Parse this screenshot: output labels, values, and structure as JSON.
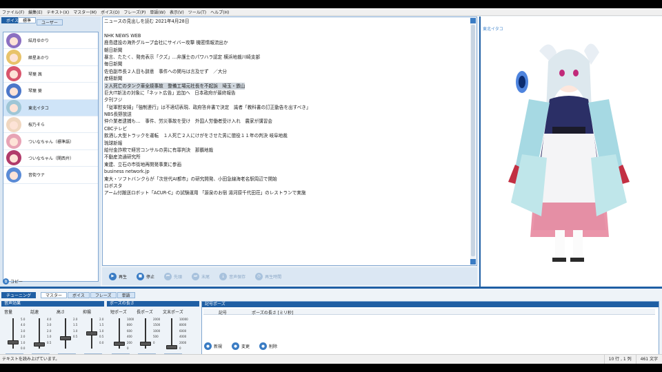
{
  "menu": [
    "ファイル(F)",
    "編集(E)",
    "テキスト(X)",
    "マスター(M)",
    "ボイス(O)",
    "フレーズ(P)",
    "単語(W)",
    "表示(V)",
    "ツール(T)",
    "ヘルプ(H)"
  ],
  "left_tabs": {
    "voice": "ボイス",
    "standard": "標準",
    "user": "ユーザー"
  },
  "voices": [
    {
      "name": "結月ゆかり",
      "color": "#8b6fc1"
    },
    {
      "name": "紲星あかり",
      "color": "#e8c36a"
    },
    {
      "name": "琴葉 茜",
      "color": "#d9556c"
    },
    {
      "name": "琴葉 葵",
      "color": "#4c77c9"
    },
    {
      "name": "東北イタコ",
      "color": "#9fc6d6"
    },
    {
      "name": "桜乃そら",
      "color": "#f0d7c0"
    },
    {
      "name": "ついなちゃん（標準語）",
      "color": "#e7a3b5"
    },
    {
      "name": "ついなちゃん（関西弁）",
      "color": "#b13b6a"
    },
    {
      "name": "音街ウナ",
      "color": "#5a8bd6"
    }
  ],
  "selected_voice_index": 4,
  "copy_label": "コピー",
  "editor_lines": [
    "ニュースの見出しを読む 2021年4月28日",
    "",
    "NHK NEWS WEB",
    "鹿島建設の海外グループ会社にサイバー攻撃 機密情報流出か",
    "朝日新聞",
    "暴言、たたく、発売表示「クズ」…弁護士のパワハラ認定 横浜地裁川崎支部",
    "毎日新聞",
    "佐伯副市長２人目も辞意　事件への関与は言及せず　／大分",
    "産経新聞",
    "２人死亡のタンク車全焼事故　整備工場元社長を不起訴　埼玉・鉄山",
    "巨大IT新法の対象に「ネット広告」追加へ　日本政府が最終報告",
    "夕刊フジ",
    "「従軍慰安婦」「強制連行」は不適切表現、政府答弁書で決定　識者「教科書の訂正動告を出すべき」",
    "NBS長野放送",
    "仲介業者逮捕も…　事件、労災事故を受け　外国人労働者受け入れ　農家が講習会",
    "CBCテレビ",
    "飲酒し大型トラックを運転　１人死亡２人にけがをさせた男に懲役１１年の判決 岐阜地裁",
    "琉球新報",
    "給付金詐欺で経営コンサルの男に有罪判決　那覇地裁",
    "不動産流通研究所",
    "東建、立石の市街地再開発事業に参画",
    "business network.jp",
    "東大・ソフトバンクらが「次世代AI都市」の研究開発、小田急線海老名駅周辺で開始",
    "ロボスタ",
    "アーム付搬送ロボット「ACUR-C」の試験運用 「源泉のお宿 湯河原千代田荘」のレストランで実施"
  ],
  "highlight_line_index": 9,
  "playbar": [
    {
      "label": "再生",
      "icon": "play-icon",
      "glyph": "▶",
      "enabled": true
    },
    {
      "label": "停止",
      "icon": "stop-icon",
      "glyph": "■",
      "enabled": true
    },
    {
      "label": "先頭",
      "icon": "skip-start-icon",
      "glyph": "⏮",
      "enabled": false
    },
    {
      "label": "末尾",
      "icon": "skip-end-icon",
      "glyph": "⏭",
      "enabled": false
    },
    {
      "label": "音声保存",
      "icon": "save-audio-icon",
      "glyph": "⤓",
      "enabled": false
    },
    {
      "label": "再生時間",
      "icon": "clock-icon",
      "glyph": "◷",
      "enabled": false
    }
  ],
  "character_label": "東北イタコ",
  "lower_tabs": {
    "tuning": "チューニング",
    "master": "マスター",
    "voice": "ボイス",
    "phrase": "フレーズ",
    "word": "単語"
  },
  "effects_title": "音声効果",
  "pause_title": "ポーズの長さ",
  "sliders": [
    {
      "label": "音量",
      "value": "1.00",
      "ticks": [
        "5.0",
        "4.0",
        "3.0",
        "2.0",
        "1.0",
        "0.0"
      ],
      "level": 0.2
    },
    {
      "label": "話速",
      "value": "1.00",
      "ticks": [
        "4.0",
        "3.0",
        "2.0",
        "1.0",
        "0.5"
      ],
      "level": 0.14
    },
    {
      "label": "高さ",
      "value": "1.00",
      "ticks": [
        "2.0",
        "1.5",
        "1.0",
        "0.5"
      ],
      "level": 0.33
    },
    {
      "label": "抑揚",
      "value": "1.00",
      "ticks": [
        "2.0",
        "1.5",
        "1.0",
        "0.5",
        "0.0"
      ],
      "level": 0.5
    },
    {
      "label": "短ポーズ",
      "value": "225",
      "ticks": [
        "1000",
        "800",
        "600",
        "400",
        "200",
        "0"
      ],
      "level": 0.16
    },
    {
      "label": "長ポーズ",
      "value": "400",
      "ticks": [
        "2000",
        "1500",
        "1000",
        "500",
        "0"
      ],
      "level": 0.16
    },
    {
      "label": "文末ポーズ",
      "value": "400",
      "ticks": [
        "10000",
        "8000",
        "6000",
        "4000",
        "2000",
        "0"
      ],
      "level": 0.04
    }
  ],
  "symbol_pause": {
    "title": "記号ポーズ",
    "col_symbol": "記号",
    "col_length": "ポーズの長さ [ミリ秒]"
  },
  "pause_actions": [
    {
      "label": "新規",
      "icon": "new-icon"
    },
    {
      "label": "変更",
      "icon": "edit-icon"
    },
    {
      "label": "削除",
      "icon": "delete-icon"
    }
  ],
  "status": {
    "message": "テキストを読み上げています。",
    "position": "10 行 , 1 列",
    "chars": "461 文字"
  }
}
